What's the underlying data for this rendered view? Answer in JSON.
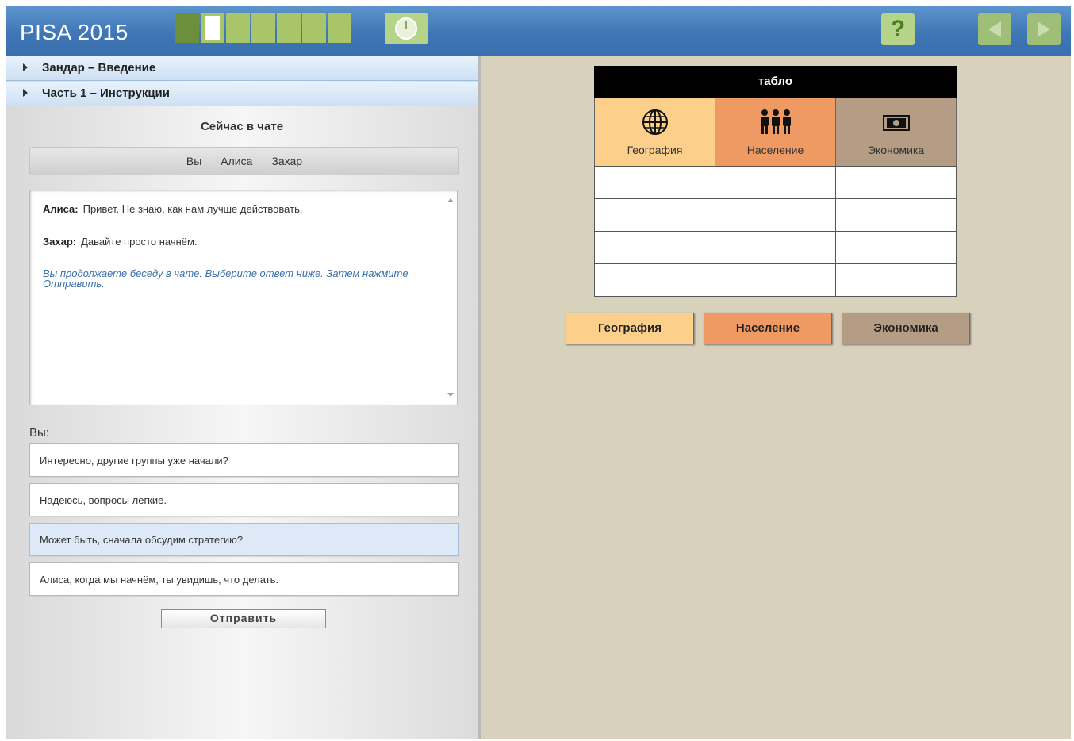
{
  "header": {
    "logo": "PISA 2015",
    "progress": {
      "total_segments": 7,
      "completed": 1,
      "current_index": 2
    },
    "colors": {
      "bar_top": "#5f95cd",
      "bar_bottom": "#3a6fae",
      "button_green": "#b6d38a"
    }
  },
  "sidebar": {
    "sections": [
      {
        "label": "Зандар – Введение"
      },
      {
        "label": "Часть 1 – Инструкции"
      }
    ],
    "chat_title": "Сейчас в чате",
    "members": [
      "Вы",
      "Алиса",
      "Захар"
    ],
    "messages": [
      {
        "author": "Алиса:",
        "text": "Привет. Не знаю, как нам лучше действовать."
      },
      {
        "author": "Захар:",
        "text": "Давайте просто начнём."
      }
    ],
    "prompt": "Вы продолжаете беседу в чате. Выберите ответ ниже. Затем нажмите Отправить.",
    "you_label": "Вы:",
    "options": [
      "Интересно, другие группы уже начали?",
      "Надеюсь, вопросы легкие.",
      "Может быть, сначала обсудим стратегию?",
      "Алиса, когда мы начнём, ты увидишь, что делать."
    ],
    "selected_option": 2,
    "send_label": "Отправить"
  },
  "board": {
    "title": "табло",
    "columns": [
      {
        "label": "География",
        "icon": "globe-icon",
        "color": "#fcd08a"
      },
      {
        "label": "Население",
        "icon": "people-icon",
        "color": "#ef9a63"
      },
      {
        "label": "Экономика",
        "icon": "money-icon",
        "color": "#b49d84"
      }
    ],
    "empty_rows": 4,
    "buttons": [
      "География",
      "Население",
      "Экономика"
    ]
  }
}
